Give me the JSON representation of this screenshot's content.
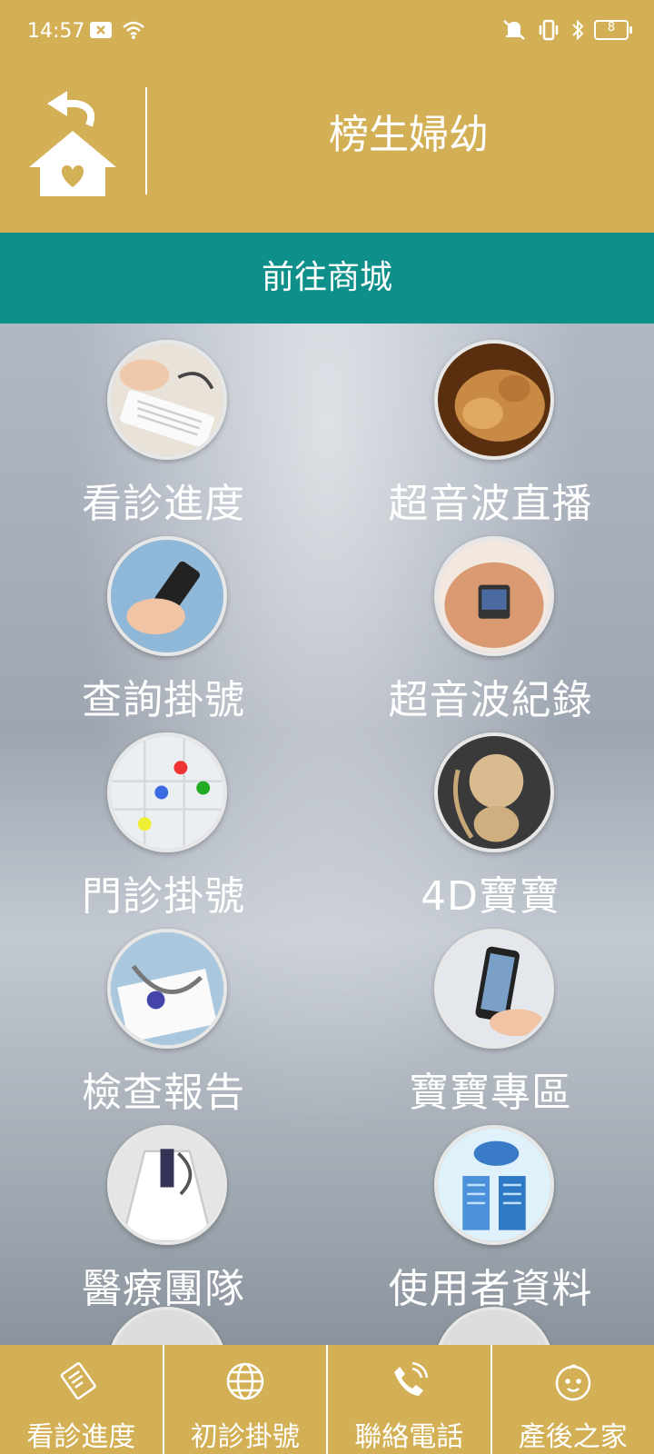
{
  "status_bar": {
    "time": "14:57",
    "battery": "8"
  },
  "header": {
    "title": "榜生婦幼"
  },
  "shop_button": {
    "label": "前往商城"
  },
  "menu": [
    {
      "label": "看診進度"
    },
    {
      "label": "超音波直播"
    },
    {
      "label": "查詢掛號"
    },
    {
      "label": "超音波紀錄"
    },
    {
      "label": "門診掛號"
    },
    {
      "label": "4D寶寶"
    },
    {
      "label": "檢查報告"
    },
    {
      "label": "寶寶專區"
    },
    {
      "label": "醫療團隊"
    },
    {
      "label": "使用者資料"
    }
  ],
  "bottom_nav": [
    {
      "label": "看診進度",
      "icon": "document-icon"
    },
    {
      "label": "初診掛號",
      "icon": "globe-icon"
    },
    {
      "label": "聯絡電話",
      "icon": "phone-icon"
    },
    {
      "label": "產後之家",
      "icon": "baby-face-icon"
    }
  ],
  "colors": {
    "gold": "#d3b056",
    "teal": "#0f8f8a"
  }
}
